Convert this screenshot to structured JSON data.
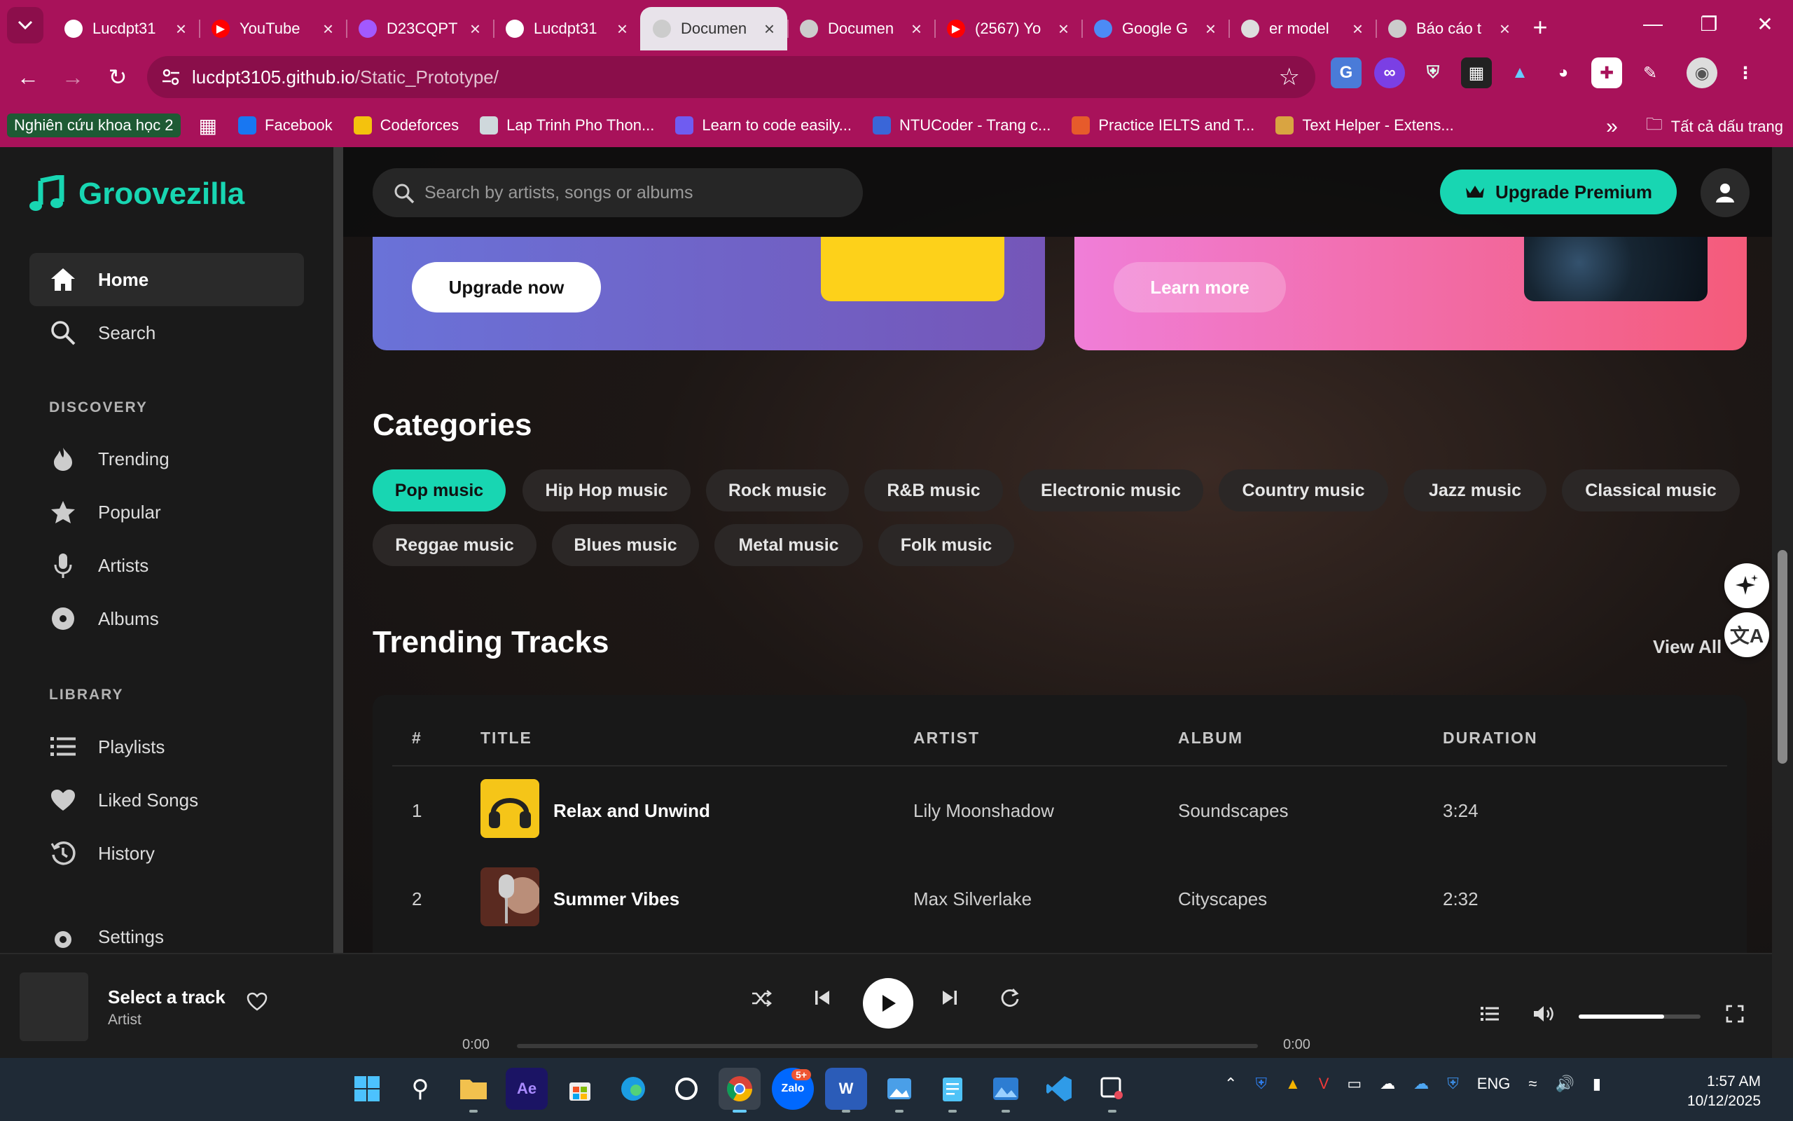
{
  "browser": {
    "tabs": [
      {
        "label": "Lucdpt31",
        "icon": "github-icon"
      },
      {
        "label": "YouTube",
        "icon": "youtube-icon"
      },
      {
        "label": "D23CQPT",
        "icon": "figma-icon"
      },
      {
        "label": "Lucdpt31",
        "icon": "github-icon"
      },
      {
        "label": "Documen",
        "icon": "globe-icon",
        "active": true
      },
      {
        "label": "Documen",
        "icon": "globe-icon"
      },
      {
        "label": "(2567) Yo",
        "icon": "youtube-icon"
      },
      {
        "label": "Google G",
        "icon": "gemini-icon"
      },
      {
        "label": "er model",
        "icon": "diagram-icon"
      },
      {
        "label": "Báo cáo t",
        "icon": "globe-icon"
      }
    ],
    "url_host": "lucdpt3105.github.io",
    "url_path": "/Static_Prototype/",
    "bookmarks": [
      {
        "label": "Facebook",
        "icon": "facebook-icon",
        "color": "#1877f2"
      },
      {
        "label": "Codeforces",
        "icon": "codeforces-icon",
        "color": "#f4c20d"
      },
      {
        "label": "Lap Trinh Pho Thon...",
        "icon": "page-icon",
        "color": "#cfd8dc"
      },
      {
        "label": "Learn to code easily...",
        "icon": "code-icon",
        "color": "#6f5cf1"
      },
      {
        "label": "NTUCoder - Trang c...",
        "icon": "ntucoder-icon",
        "color": "#3a66d8"
      },
      {
        "label": "Practice IELTS and T...",
        "icon": "shield-icon",
        "color": "#e65b2b"
      },
      {
        "label": "Text Helper - Extens...",
        "icon": "puzzle-icon",
        "color": "#d9a441"
      }
    ],
    "bookmark_group": "Nghiên cứu khoa học 2",
    "all_bookmarks": "Tất cả dấu trang"
  },
  "app": {
    "brand": "Groovezilla",
    "accent": "#18d6b2",
    "nav": [
      {
        "label": "Home",
        "icon": "home-icon",
        "active": true
      },
      {
        "label": "Search",
        "icon": "search-icon"
      }
    ],
    "discovery_heading": "DISCOVERY",
    "discovery": [
      {
        "label": "Trending",
        "icon": "fire-icon"
      },
      {
        "label": "Popular",
        "icon": "star-icon"
      },
      {
        "label": "Artists",
        "icon": "microphone-icon"
      },
      {
        "label": "Albums",
        "icon": "disc-icon"
      }
    ],
    "library_heading": "LIBRARY",
    "library": [
      {
        "label": "Playlists",
        "icon": "list-icon"
      },
      {
        "label": "Liked Songs",
        "icon": "heart-icon"
      },
      {
        "label": "History",
        "icon": "history-icon"
      }
    ],
    "settings": "Settings",
    "search_placeholder": "Search by artists, songs or albums",
    "upgrade_premium": "Upgrade Premium",
    "banner_upgrade_cta": "Upgrade now",
    "banner_learn_cta": "Learn more",
    "categories_title": "Categories",
    "categories": [
      "Pop music",
      "Hip Hop music",
      "Rock music",
      "R&B music",
      "Electronic music",
      "Country music",
      "Jazz music",
      "Classical music",
      "Reggae music",
      "Blues music",
      "Metal music",
      "Folk music"
    ],
    "active_category": "Pop music",
    "trending_title": "Trending Tracks",
    "view_all": "View All",
    "table_headers": [
      "#",
      "TITLE",
      "ARTIST",
      "ALBUM",
      "DURATION"
    ],
    "tracks": [
      {
        "num": "1",
        "title": "Relax and Unwind",
        "artist": "Lily Moonshadow",
        "album": "Soundscapes",
        "duration": "3:24"
      },
      {
        "num": "2",
        "title": "Summer Vibes",
        "artist": "Max Silverlake",
        "album": "Cityscapes",
        "duration": "2:32"
      }
    ]
  },
  "player": {
    "title": "Select a track",
    "artist": "Artist",
    "time_current": "0:00",
    "time_total": "0:00",
    "volume": 0.7
  },
  "taskbar": {
    "lang": "ENG",
    "time": "1:57 AM",
    "date": "10/12/2025",
    "zalo_badge": "5+"
  }
}
